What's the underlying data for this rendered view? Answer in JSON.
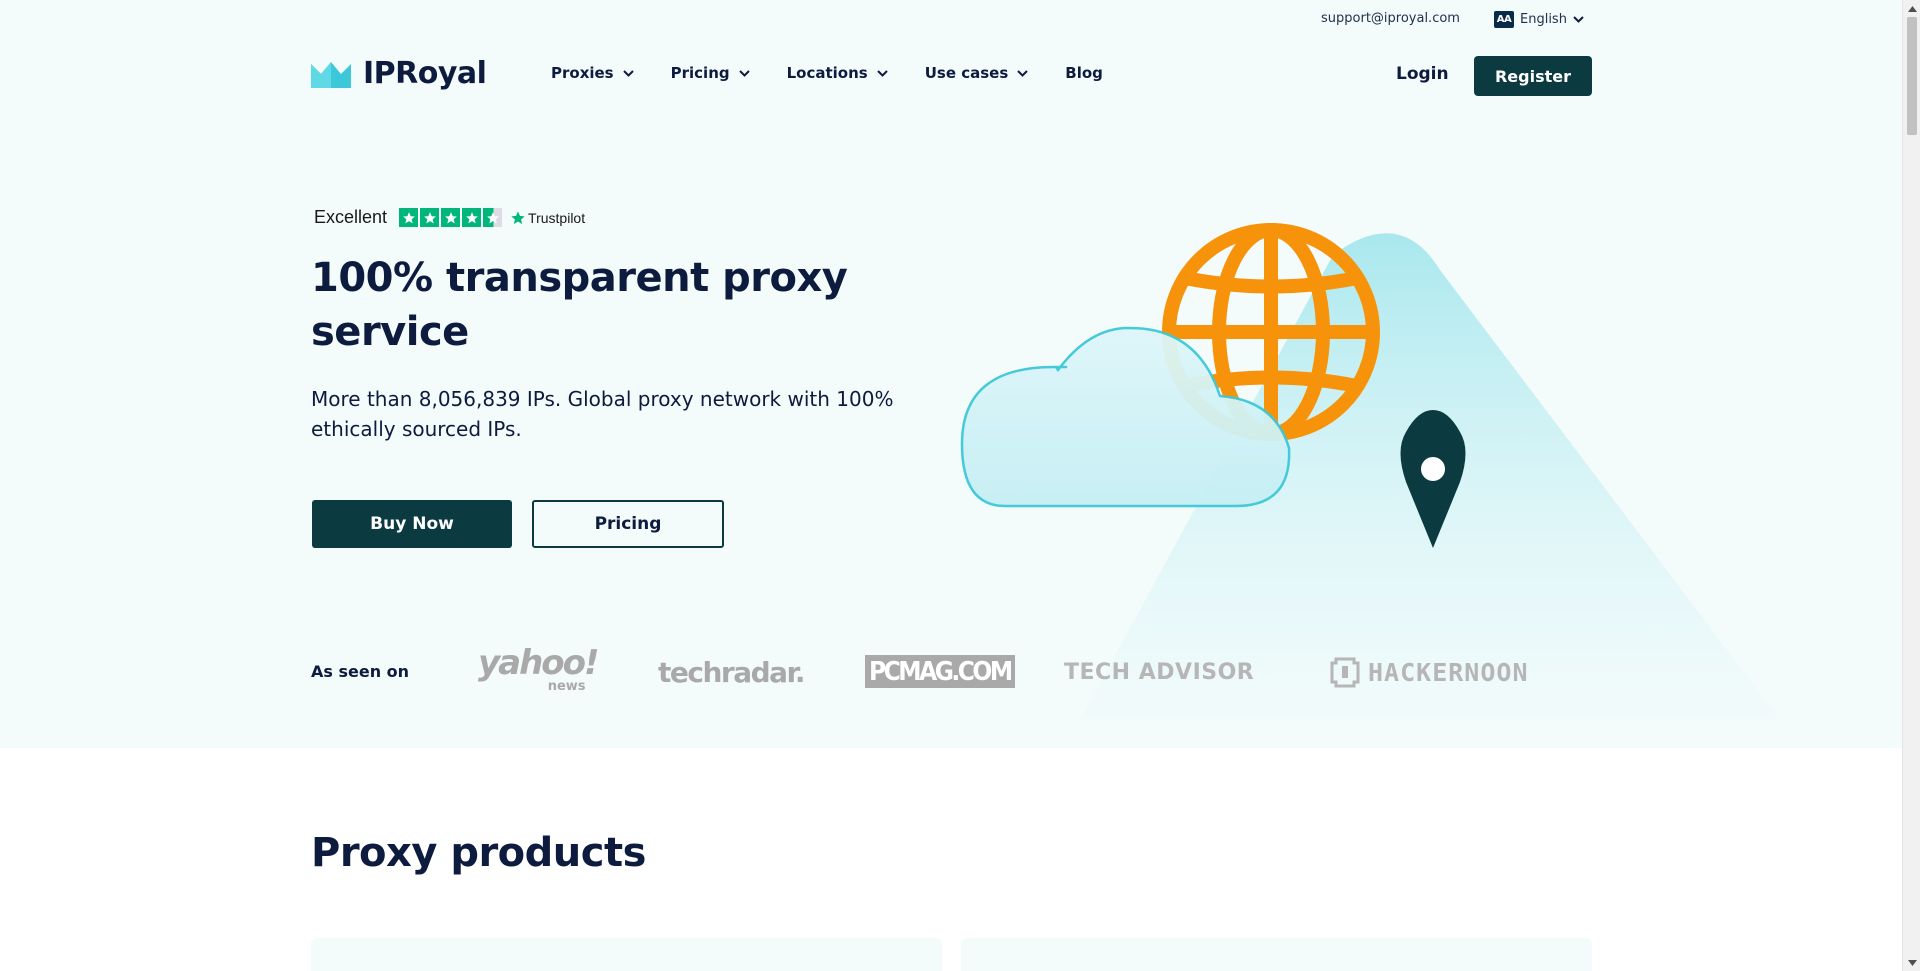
{
  "utility": {
    "email": "support@iproyal.com",
    "language_badge": "AA",
    "language": "English"
  },
  "header": {
    "logo_text": "IPRoyal",
    "nav": [
      {
        "label": "Proxies",
        "has_dropdown": true
      },
      {
        "label": "Pricing",
        "has_dropdown": true
      },
      {
        "label": "Locations",
        "has_dropdown": true
      },
      {
        "label": "Use cases",
        "has_dropdown": true
      },
      {
        "label": "Blog",
        "has_dropdown": false
      }
    ],
    "login_label": "Login",
    "register_label": "Register"
  },
  "trustpilot": {
    "rating_text": "Excellent",
    "stars": 4.5,
    "brand": "Trustpilot"
  },
  "hero": {
    "title": "100% transparent proxy service",
    "subtitle": "More than 8,056,839 IPs. Global proxy network with 100% ethically sourced IPs.",
    "buy_label": "Buy Now",
    "pricing_label": "Pricing"
  },
  "press": {
    "label": "As seen on",
    "yahoo": "yahoo!",
    "yahoo_sub": "news",
    "techradar": "techradar.",
    "pcmag": "PCMAG.COM",
    "techadvisor": "TECH ADVISOR",
    "hackernoon": "HACKERNOON"
  },
  "products": {
    "title": "Proxy products"
  },
  "colors": {
    "primary": "#0b3b40",
    "accent_cyan": "#3cc8d8",
    "globe_orange": "#f7930a",
    "text_dark": "#0d1b3e",
    "hero_bg": "#f4fbfb",
    "trustpilot_green": "#00b67a"
  }
}
